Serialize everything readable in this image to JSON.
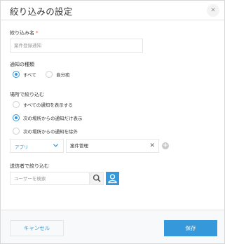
{
  "dialog": {
    "title": "絞り込みの設定",
    "close_icon": "close-icon"
  },
  "name_section": {
    "label": "絞り込み名",
    "required_mark": "*",
    "value": "案件登録通知"
  },
  "notification_type": {
    "label": "通知の種類",
    "options": [
      {
        "label": "すべて",
        "selected": true
      },
      {
        "label": "自分宛",
        "selected": false
      }
    ]
  },
  "place_filter": {
    "label": "場所で絞り込む",
    "options": [
      {
        "label": "すべての通知を表示する",
        "selected": false
      },
      {
        "label": "次の場所からの通知だけ表示",
        "selected": true
      },
      {
        "label": "次の場所からの通知を除外",
        "selected": false
      }
    ],
    "type_select": {
      "value": "アプリ",
      "icon": "chevron-down-icon"
    },
    "place_value": "案件管理",
    "clear_icon": "clear-icon",
    "add_icon": "add-circle-icon"
  },
  "sender_filter": {
    "label": "送信者で絞り込む",
    "placeholder": "ユーザーを検索",
    "search_icon": "search-icon",
    "user_icon": "user-icon"
  },
  "footer": {
    "cancel_label": "キャンセル",
    "save_label": "保存"
  },
  "colors": {
    "accent": "#3498db",
    "required": "#e74c3c",
    "border": "#e3e7e8",
    "footer_bg": "#f7f9fa"
  }
}
